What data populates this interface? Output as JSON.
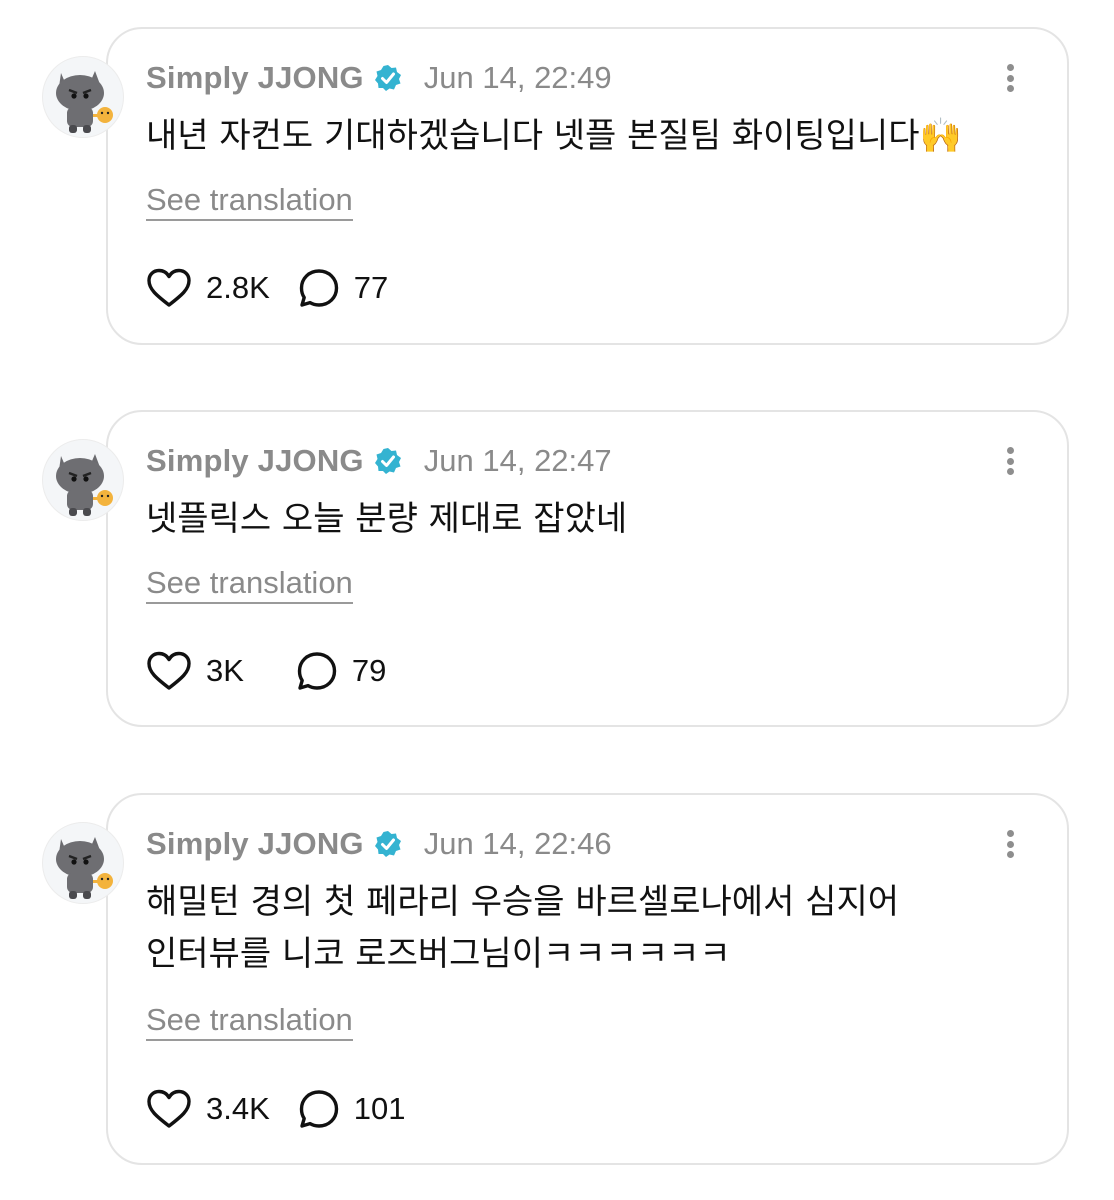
{
  "posts": [
    {
      "author": "Simply JJONG",
      "timestamp": "Jun 14, 22:49",
      "text_lines": [
        "내년 자컨도 기대하겠습니다 넷플 본질팀 화이팅입니다🙌"
      ],
      "see_translation": "See translation",
      "likes": "2.8K",
      "replies": "77"
    },
    {
      "author": "Simply JJONG",
      "timestamp": "Jun 14, 22:47",
      "text_lines": [
        "넷플릭스 오늘 분량 제대로 잡았네"
      ],
      "see_translation": "See translation",
      "likes": "3K",
      "replies": "79"
    },
    {
      "author": "Simply JJONG",
      "timestamp": "Jun 14, 22:46",
      "text_lines": [
        "해밀턴 경의 첫 페라리 우승을 바르셀로나에서 심지어",
        "인터뷰를 니코 로즈버그님이ㅋㅋㅋㅋㅋㅋ"
      ],
      "see_translation": "See translation",
      "likes": "3.4K",
      "replies": "101"
    }
  ],
  "icons": {
    "verified": "verified-badge-icon",
    "like": "heart-icon",
    "reply": "speech-bubble-icon",
    "more": "more-vertical-icon"
  },
  "colors": {
    "verified": "#34b3d1",
    "muted": "#8a8a8a",
    "border": "#e4e4e4"
  }
}
